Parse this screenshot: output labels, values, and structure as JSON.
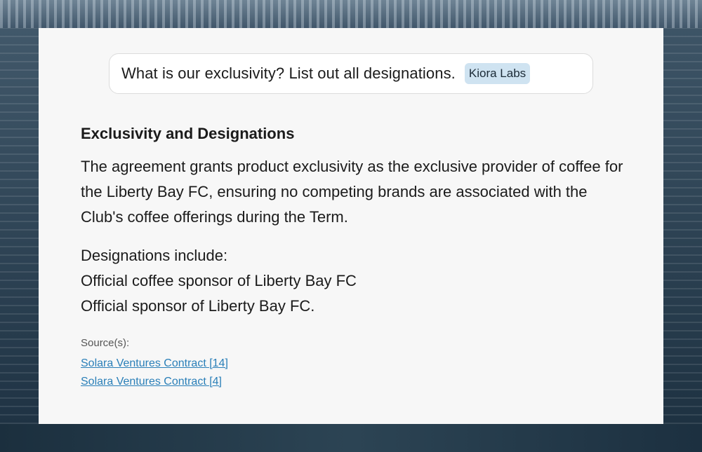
{
  "query": {
    "text": "What is our exclusivity? List out all designations.",
    "org_badge": "Kiora Labs"
  },
  "answer": {
    "heading": "Exclusivity and Designations",
    "paragraph": "The agreement grants product exclusivity as the exclusive provider of coffee for the Liberty Bay FC, ensuring no competing brands are associated with the Club's coffee offerings during the Term.",
    "designations_intro": "Designations include:",
    "designations": [
      "Official coffee sponsor of Liberty Bay FC",
      "Official sponsor of Liberty Bay FC."
    ]
  },
  "sources": {
    "label": "Source(s):",
    "links": [
      "Solara Ventures Contract [14]",
      "Solara Ventures Contract [4]"
    ]
  },
  "colors": {
    "panel_bg": "#f7f7f7",
    "badge_bg": "#cfe3f1",
    "link": "#2a7fb8"
  }
}
